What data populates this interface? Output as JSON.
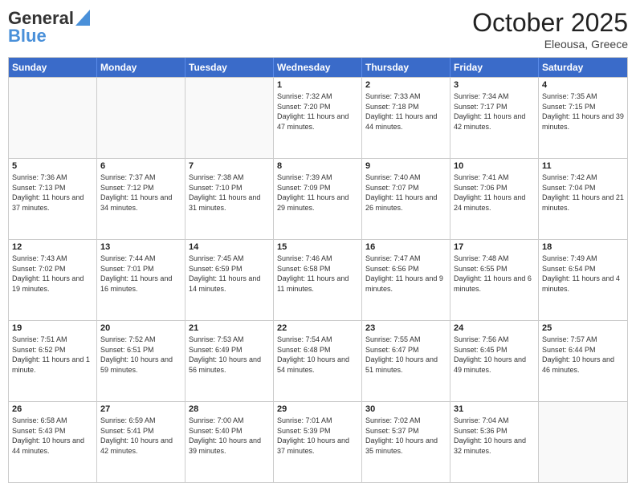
{
  "header": {
    "logo_general": "General",
    "logo_blue": "Blue",
    "month": "October 2025",
    "location": "Eleousa, Greece"
  },
  "days_of_week": [
    "Sunday",
    "Monday",
    "Tuesday",
    "Wednesday",
    "Thursday",
    "Friday",
    "Saturday"
  ],
  "weeks": [
    [
      {
        "day": "",
        "text": ""
      },
      {
        "day": "",
        "text": ""
      },
      {
        "day": "",
        "text": ""
      },
      {
        "day": "1",
        "text": "Sunrise: 7:32 AM\nSunset: 7:20 PM\nDaylight: 11 hours and 47 minutes."
      },
      {
        "day": "2",
        "text": "Sunrise: 7:33 AM\nSunset: 7:18 PM\nDaylight: 11 hours and 44 minutes."
      },
      {
        "day": "3",
        "text": "Sunrise: 7:34 AM\nSunset: 7:17 PM\nDaylight: 11 hours and 42 minutes."
      },
      {
        "day": "4",
        "text": "Sunrise: 7:35 AM\nSunset: 7:15 PM\nDaylight: 11 hours and 39 minutes."
      }
    ],
    [
      {
        "day": "5",
        "text": "Sunrise: 7:36 AM\nSunset: 7:13 PM\nDaylight: 11 hours and 37 minutes."
      },
      {
        "day": "6",
        "text": "Sunrise: 7:37 AM\nSunset: 7:12 PM\nDaylight: 11 hours and 34 minutes."
      },
      {
        "day": "7",
        "text": "Sunrise: 7:38 AM\nSunset: 7:10 PM\nDaylight: 11 hours and 31 minutes."
      },
      {
        "day": "8",
        "text": "Sunrise: 7:39 AM\nSunset: 7:09 PM\nDaylight: 11 hours and 29 minutes."
      },
      {
        "day": "9",
        "text": "Sunrise: 7:40 AM\nSunset: 7:07 PM\nDaylight: 11 hours and 26 minutes."
      },
      {
        "day": "10",
        "text": "Sunrise: 7:41 AM\nSunset: 7:06 PM\nDaylight: 11 hours and 24 minutes."
      },
      {
        "day": "11",
        "text": "Sunrise: 7:42 AM\nSunset: 7:04 PM\nDaylight: 11 hours and 21 minutes."
      }
    ],
    [
      {
        "day": "12",
        "text": "Sunrise: 7:43 AM\nSunset: 7:02 PM\nDaylight: 11 hours and 19 minutes."
      },
      {
        "day": "13",
        "text": "Sunrise: 7:44 AM\nSunset: 7:01 PM\nDaylight: 11 hours and 16 minutes."
      },
      {
        "day": "14",
        "text": "Sunrise: 7:45 AM\nSunset: 6:59 PM\nDaylight: 11 hours and 14 minutes."
      },
      {
        "day": "15",
        "text": "Sunrise: 7:46 AM\nSunset: 6:58 PM\nDaylight: 11 hours and 11 minutes."
      },
      {
        "day": "16",
        "text": "Sunrise: 7:47 AM\nSunset: 6:56 PM\nDaylight: 11 hours and 9 minutes."
      },
      {
        "day": "17",
        "text": "Sunrise: 7:48 AM\nSunset: 6:55 PM\nDaylight: 11 hours and 6 minutes."
      },
      {
        "day": "18",
        "text": "Sunrise: 7:49 AM\nSunset: 6:54 PM\nDaylight: 11 hours and 4 minutes."
      }
    ],
    [
      {
        "day": "19",
        "text": "Sunrise: 7:51 AM\nSunset: 6:52 PM\nDaylight: 11 hours and 1 minute."
      },
      {
        "day": "20",
        "text": "Sunrise: 7:52 AM\nSunset: 6:51 PM\nDaylight: 10 hours and 59 minutes."
      },
      {
        "day": "21",
        "text": "Sunrise: 7:53 AM\nSunset: 6:49 PM\nDaylight: 10 hours and 56 minutes."
      },
      {
        "day": "22",
        "text": "Sunrise: 7:54 AM\nSunset: 6:48 PM\nDaylight: 10 hours and 54 minutes."
      },
      {
        "day": "23",
        "text": "Sunrise: 7:55 AM\nSunset: 6:47 PM\nDaylight: 10 hours and 51 minutes."
      },
      {
        "day": "24",
        "text": "Sunrise: 7:56 AM\nSunset: 6:45 PM\nDaylight: 10 hours and 49 minutes."
      },
      {
        "day": "25",
        "text": "Sunrise: 7:57 AM\nSunset: 6:44 PM\nDaylight: 10 hours and 46 minutes."
      }
    ],
    [
      {
        "day": "26",
        "text": "Sunrise: 6:58 AM\nSunset: 5:43 PM\nDaylight: 10 hours and 44 minutes."
      },
      {
        "day": "27",
        "text": "Sunrise: 6:59 AM\nSunset: 5:41 PM\nDaylight: 10 hours and 42 minutes."
      },
      {
        "day": "28",
        "text": "Sunrise: 7:00 AM\nSunset: 5:40 PM\nDaylight: 10 hours and 39 minutes."
      },
      {
        "day": "29",
        "text": "Sunrise: 7:01 AM\nSunset: 5:39 PM\nDaylight: 10 hours and 37 minutes."
      },
      {
        "day": "30",
        "text": "Sunrise: 7:02 AM\nSunset: 5:37 PM\nDaylight: 10 hours and 35 minutes."
      },
      {
        "day": "31",
        "text": "Sunrise: 7:04 AM\nSunset: 5:36 PM\nDaylight: 10 hours and 32 minutes."
      },
      {
        "day": "",
        "text": ""
      }
    ]
  ]
}
